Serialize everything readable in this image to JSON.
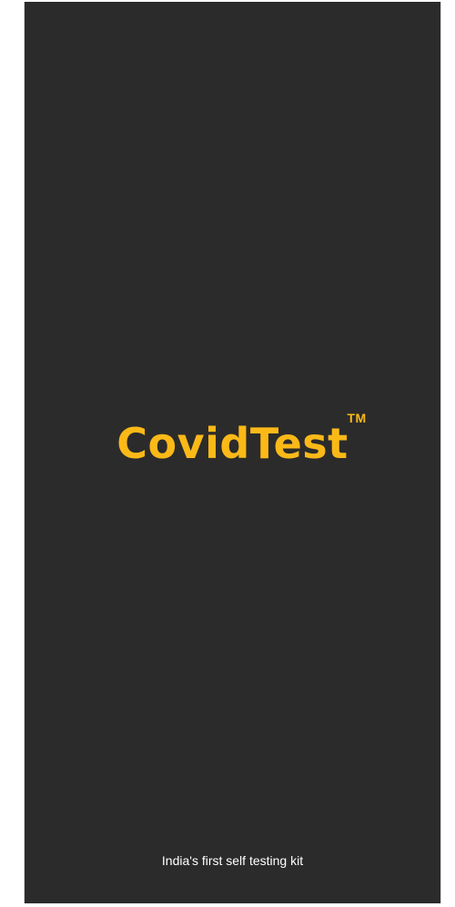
{
  "splash": {
    "brand_name": "CovidTest",
    "trademark": "TM",
    "tagline": "India's first self testing kit"
  },
  "colors": {
    "background": "#2b2b2b",
    "brand": "#fbb918",
    "tagline_text": "#ffffff"
  }
}
